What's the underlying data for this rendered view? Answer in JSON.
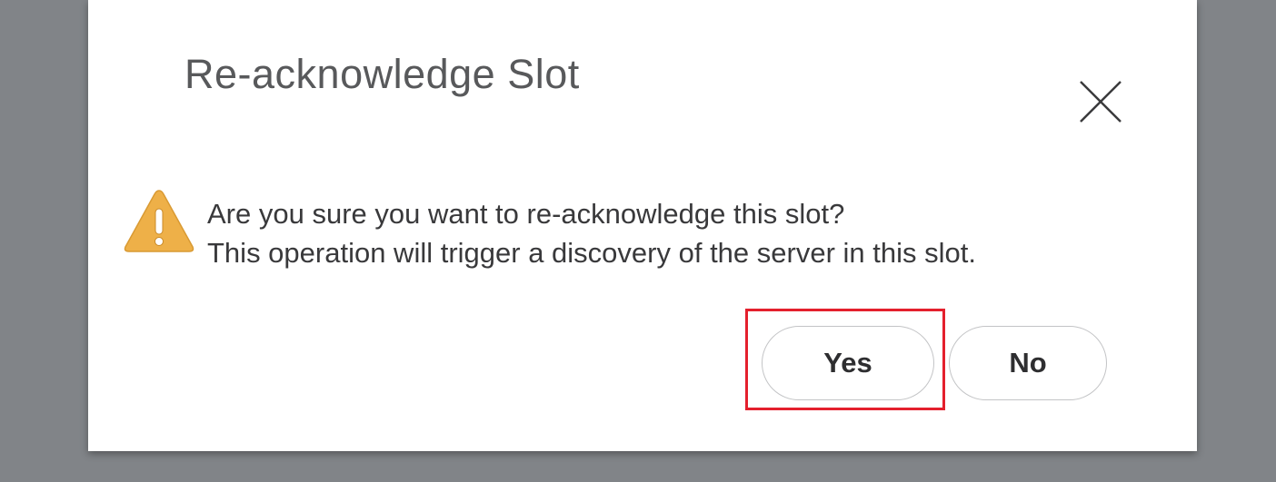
{
  "dialog": {
    "title": "Re-acknowledge Slot",
    "close_icon": "close-icon",
    "warning_icon": "warning-triangle-icon",
    "message_line1": "Are you sure you want to re-acknowledge this slot?",
    "message_line2": "This operation will trigger a discovery of the server in this slot.",
    "buttons": {
      "yes_label": "Yes",
      "no_label": "No"
    }
  },
  "colors": {
    "backdrop": "#818488",
    "dialog_background": "#ffffff",
    "title_text": "#58595b",
    "body_text": "#39393b",
    "warning_fill": "#eeb048",
    "button_border": "#c3c4c6",
    "highlight_border": "#e4202d"
  }
}
